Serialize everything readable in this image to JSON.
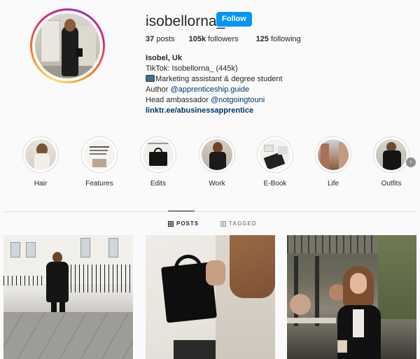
{
  "profile": {
    "username": "isobellorna_",
    "follow_label": "Follow",
    "stats": {
      "posts_count": "37",
      "posts_label": "posts",
      "followers_count": "105k",
      "followers_label": "followers",
      "following_count": "125",
      "following_label": "following"
    },
    "bio": {
      "name": "Isobel, Uk",
      "line1": "TikTok: Isobellorna_ (445k)",
      "line2": "Marketing assistant & degree student",
      "line3_prefix": "Author ",
      "line3_mention": "@apprenticeship.guide",
      "line4_prefix": "Head ambassador ",
      "line4_mention": "@notgoingtouni",
      "link": "linktr.ee/abusinessapprentice"
    }
  },
  "highlights": [
    {
      "label": "Hair"
    },
    {
      "label": "Features"
    },
    {
      "label": "Edits"
    },
    {
      "label": "Work"
    },
    {
      "label": "E-Book"
    },
    {
      "label": "Life"
    },
    {
      "label": "Outfits"
    }
  ],
  "tabs": {
    "posts": "POSTS",
    "tagged": "TAGGED"
  },
  "icons": {
    "grid": "grid-icon",
    "tagged": "tagged-icon",
    "next": "chevron-right-icon"
  },
  "colors": {
    "accent": "#0095f6",
    "link": "#00376b",
    "text": "#262626",
    "muted": "#8e8e8e"
  }
}
